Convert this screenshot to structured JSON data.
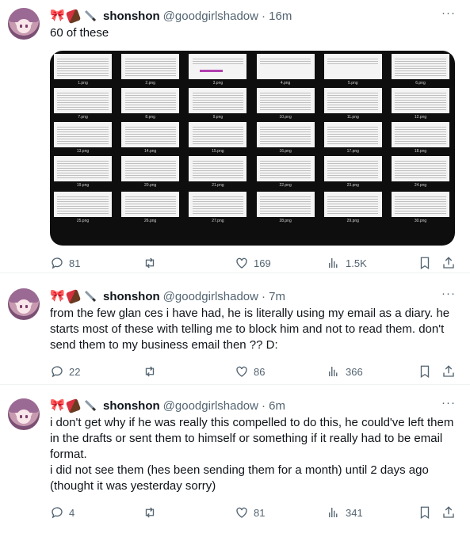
{
  "author": {
    "name": "shonshon",
    "handle": "@goodgirlshadow"
  },
  "tweets": [
    {
      "time": "· 16m",
      "text": "60 of these",
      "stats": {
        "replies": "81",
        "likes": "169",
        "views": "1.5K"
      },
      "media": {
        "captions": [
          "1.png",
          "2.png",
          "3.png",
          "4.png",
          "5.png",
          "6.png",
          "7.png",
          "8.png",
          "9.png",
          "10.png",
          "11.png",
          "12.png",
          "13.png",
          "14.png",
          "15.png",
          "16.png",
          "17.png",
          "18.png",
          "19.png",
          "20.png",
          "21.png",
          "22.png",
          "23.png",
          "24.png",
          "25.png",
          "26.png",
          "27.png",
          "28.png",
          "29.png",
          "30.png"
        ]
      }
    },
    {
      "time": "· 7m",
      "text": "from the few glan ces i have had, he is literally using my email as a diary. he starts most of these with telling me to block him and not to read them. don't send them to my business email then ?? D:",
      "stats": {
        "replies": "22",
        "likes": "86",
        "views": "366"
      }
    },
    {
      "time": "· 6m",
      "text": "i don't get why if he was really this compelled to do this, he could've left them in the drafts or sent them to himself or something if it really had to be email format.\ni did not see them (hes been sending them for a month) until 2 days ago (thought it was yesterday sorry)",
      "stats": {
        "replies": "4",
        "likes": "81",
        "views": "341"
      }
    }
  ],
  "icons": [
    "bow-emoji",
    "chocolate-emoji",
    "knife-emoji",
    "more-icon",
    "reply-icon",
    "retweet-icon",
    "like-icon",
    "views-icon",
    "bookmark-icon",
    "share-icon"
  ]
}
